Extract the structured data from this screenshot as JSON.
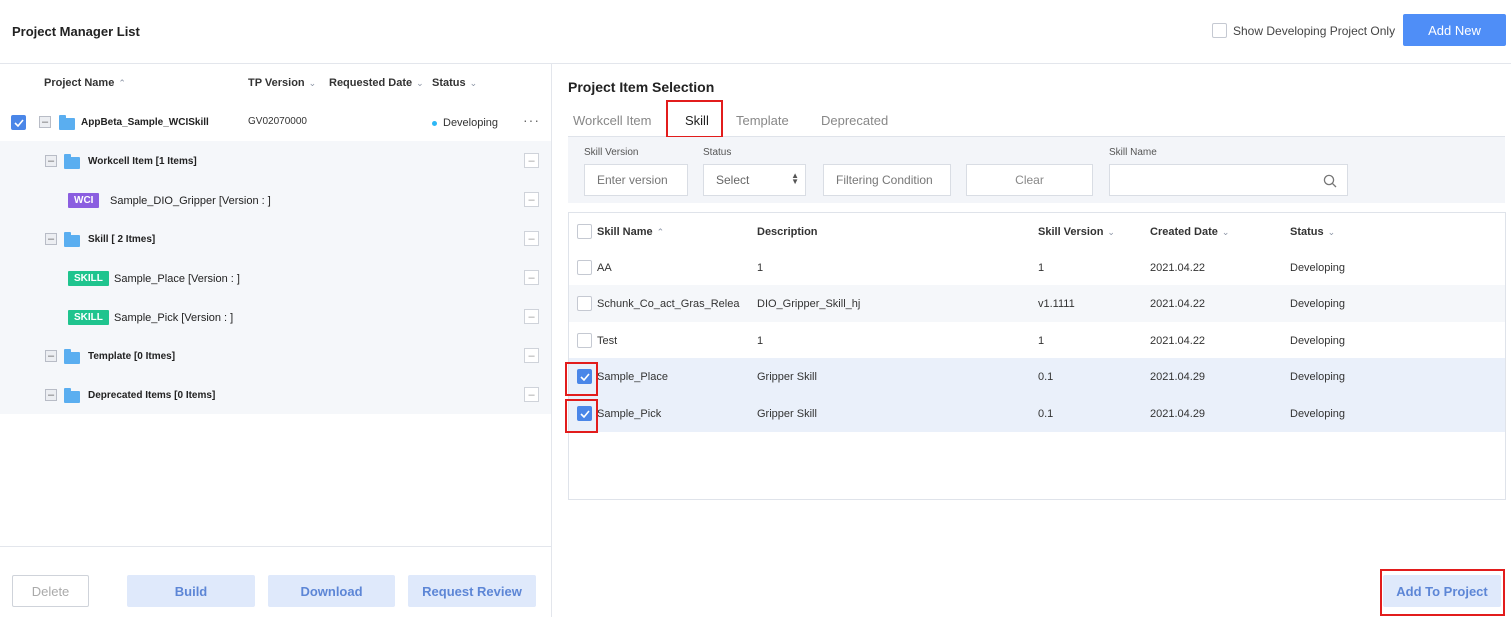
{
  "header": {
    "title": "Project Manager List",
    "show_dev_label": "Show Developing Project Only",
    "add_new_label": "Add New"
  },
  "left": {
    "columns": {
      "name": "Project Name",
      "tp": "TP Version",
      "date": "Requested Date",
      "status": "Status"
    },
    "project": {
      "name": "AppBeta_Sample_WCISkill",
      "tp": "GV02070000",
      "status": "Developing",
      "more": "···"
    },
    "tree": {
      "workcell": "Workcell Item [1 Items]",
      "wci_tag": "WCI",
      "wci_item": "Sample_DIO_Gripper [Version : ]",
      "skill": "Skill [ 2 Itmes]",
      "skill_tag": "SKILL",
      "skill_item1": "Sample_Place [Version : ]",
      "skill_item2": "Sample_Pick [Version : ]",
      "template": "Template [0 Itmes]",
      "deprecated": "Deprecated Items [0 Items]"
    },
    "footer": {
      "delete": "Delete",
      "build": "Build",
      "download": "Download",
      "review": "Request Review"
    }
  },
  "right": {
    "title": "Project Item Selection",
    "tabs": [
      "Workcell Item",
      "Skill",
      "Template",
      "Deprecated"
    ],
    "filters": {
      "version_label": "Skill Version",
      "version_placeholder": "Enter version",
      "status_label": "Status",
      "status_value": "Select",
      "condition": "Filtering Condition",
      "clear": "Clear",
      "name_label": "Skill Name"
    },
    "table": {
      "headers": {
        "name": "Skill Name",
        "desc": "Description",
        "version": "Skill Version",
        "date": "Created Date",
        "status": "Status"
      },
      "rows": [
        {
          "name": "AA",
          "desc": "1",
          "version": "1",
          "date": "2021.04.22",
          "status": "Developing",
          "checked": false
        },
        {
          "name": "Schunk_Co_act_Gras_Relea",
          "desc": "DIO_Gripper_Skill_hj",
          "version": "v1.1111",
          "date": "2021.04.22",
          "status": "Developing",
          "checked": false
        },
        {
          "name": "Test",
          "desc": "1",
          "version": "1",
          "date": "2021.04.22",
          "status": "Developing",
          "checked": false
        },
        {
          "name": "Sample_Place",
          "desc": "Gripper Skill",
          "version": "0.1",
          "date": "2021.04.29",
          "status": "Developing",
          "checked": true
        },
        {
          "name": "Sample_Pick",
          "desc": "Gripper Skill",
          "version": "0.1",
          "date": "2021.04.29",
          "status": "Developing",
          "checked": true
        }
      ]
    },
    "add_to_project": "Add To Project"
  },
  "colors": {
    "accent": "#4f8ef7",
    "highlight": "#e21c1c",
    "wci_tag": "#8b5ee0",
    "skill_tag": "#1fc48e",
    "status_dot": "#2db7f5"
  }
}
